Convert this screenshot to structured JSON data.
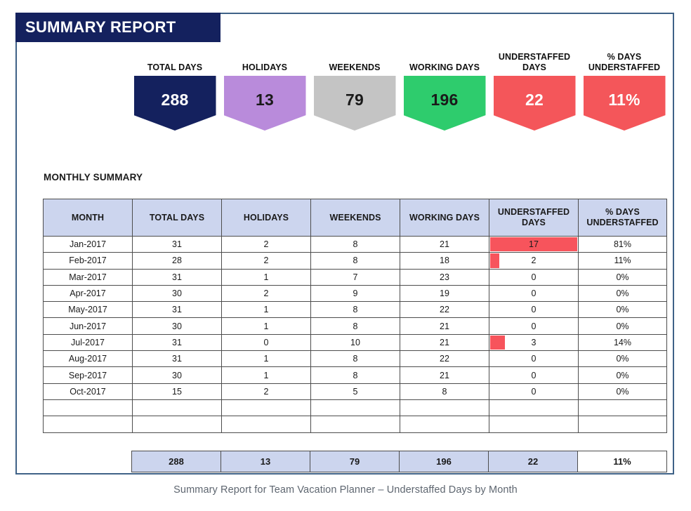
{
  "report": {
    "title": "SUMMARY REPORT",
    "section_heading": "MONTHLY SUMMARY",
    "caption": "Summary Report for Team Vacation Planner – Understaffed Days by Month"
  },
  "colors": {
    "title_bar": "#14215e",
    "frame_border": "#3f6287",
    "header_fill": "#ccd5ee",
    "databar": "#f7545c",
    "kpi_total_days": "#14215e",
    "kpi_holidays": "#b98bdb",
    "kpi_weekends": "#c4c4c4",
    "kpi_working_days": "#2ecc6d",
    "kpi_understaffed_days": "#f4565a",
    "kpi_pct_understaffed": "#f4565a"
  },
  "kpis": [
    {
      "label_line1": "TOTAL DAYS",
      "label_line2": "",
      "value": "288",
      "fill": "#14215e",
      "text_color": "#ffffff"
    },
    {
      "label_line1": "HOLIDAYS",
      "label_line2": "",
      "value": "13",
      "fill": "#b98bdb",
      "text_color": "#1a1a1a"
    },
    {
      "label_line1": "WEEKENDS",
      "label_line2": "",
      "value": "79",
      "fill": "#c4c4c4",
      "text_color": "#1a1a1a"
    },
    {
      "label_line1": "WORKING DAYS",
      "label_line2": "",
      "value": "196",
      "fill": "#2ecc6d",
      "text_color": "#1a1a1a"
    },
    {
      "label_line1": "UNDERSTAFFED",
      "label_line2": "DAYS",
      "value": "22",
      "fill": "#f4565a",
      "text_color": "#ffffff"
    },
    {
      "label_line1": "% DAYS",
      "label_line2": "UNDERSTAFFED",
      "value": "11%",
      "fill": "#f4565a",
      "text_color": "#ffffff"
    }
  ],
  "table": {
    "columns": [
      {
        "line1": "MONTH",
        "line2": ""
      },
      {
        "line1": "TOTAL DAYS",
        "line2": ""
      },
      {
        "line1": "HOLIDAYS",
        "line2": ""
      },
      {
        "line1": "WEEKENDS",
        "line2": ""
      },
      {
        "line1": "WORKING DAYS",
        "line2": ""
      },
      {
        "line1": "UNDERSTAFFED",
        "line2": "DAYS"
      },
      {
        "line1": "% DAYS",
        "line2": "UNDERSTAFFED"
      }
    ],
    "rows": [
      {
        "month": "Jan-2017",
        "total_days": "31",
        "holidays": "2",
        "weekends": "8",
        "working_days": "21",
        "understaffed_days": "17",
        "databar_pct": 100,
        "pct_understaffed": "81%"
      },
      {
        "month": "Feb-2017",
        "total_days": "28",
        "holidays": "2",
        "weekends": "8",
        "working_days": "18",
        "understaffed_days": "2",
        "databar_pct": 12,
        "pct_understaffed": "11%"
      },
      {
        "month": "Mar-2017",
        "total_days": "31",
        "holidays": "1",
        "weekends": "7",
        "working_days": "23",
        "understaffed_days": "0",
        "databar_pct": 0,
        "pct_understaffed": "0%"
      },
      {
        "month": "Apr-2017",
        "total_days": "30",
        "holidays": "2",
        "weekends": "9",
        "working_days": "19",
        "understaffed_days": "0",
        "databar_pct": 0,
        "pct_understaffed": "0%"
      },
      {
        "month": "May-2017",
        "total_days": "31",
        "holidays": "1",
        "weekends": "8",
        "working_days": "22",
        "understaffed_days": "0",
        "databar_pct": 0,
        "pct_understaffed": "0%"
      },
      {
        "month": "Jun-2017",
        "total_days": "30",
        "holidays": "1",
        "weekends": "8",
        "working_days": "21",
        "understaffed_days": "0",
        "databar_pct": 0,
        "pct_understaffed": "0%"
      },
      {
        "month": "Jul-2017",
        "total_days": "31",
        "holidays": "0",
        "weekends": "10",
        "working_days": "21",
        "understaffed_days": "3",
        "databar_pct": 18,
        "pct_understaffed": "14%"
      },
      {
        "month": "Aug-2017",
        "total_days": "31",
        "holidays": "1",
        "weekends": "8",
        "working_days": "22",
        "understaffed_days": "0",
        "databar_pct": 0,
        "pct_understaffed": "0%"
      },
      {
        "month": "Sep-2017",
        "total_days": "30",
        "holidays": "1",
        "weekends": "8",
        "working_days": "21",
        "understaffed_days": "0",
        "databar_pct": 0,
        "pct_understaffed": "0%"
      },
      {
        "month": "Oct-2017",
        "total_days": "15",
        "holidays": "2",
        "weekends": "5",
        "working_days": "8",
        "understaffed_days": "0",
        "databar_pct": 0,
        "pct_understaffed": "0%"
      }
    ],
    "blank_rows": 2,
    "totals": {
      "total_days": "288",
      "holidays": "13",
      "weekends": "79",
      "working_days": "196",
      "understaffed_days": "22",
      "pct_understaffed": "11%"
    }
  },
  "chart_data": {
    "type": "table",
    "title": "Monthly Summary – Understaffed Days by Month",
    "categories": [
      "Jan-2017",
      "Feb-2017",
      "Mar-2017",
      "Apr-2017",
      "May-2017",
      "Jun-2017",
      "Jul-2017",
      "Aug-2017",
      "Sep-2017",
      "Oct-2017"
    ],
    "series": [
      {
        "name": "Total Days",
        "values": [
          31,
          28,
          31,
          30,
          31,
          30,
          31,
          31,
          30,
          15
        ]
      },
      {
        "name": "Holidays",
        "values": [
          2,
          2,
          1,
          2,
          1,
          1,
          0,
          1,
          1,
          2
        ]
      },
      {
        "name": "Weekends",
        "values": [
          8,
          8,
          7,
          9,
          8,
          8,
          10,
          8,
          8,
          5
        ]
      },
      {
        "name": "Working Days",
        "values": [
          21,
          18,
          23,
          19,
          22,
          21,
          21,
          22,
          21,
          8
        ]
      },
      {
        "name": "Understaffed Days",
        "values": [
          17,
          2,
          0,
          0,
          0,
          0,
          3,
          0,
          0,
          0
        ]
      },
      {
        "name": "% Days Understaffed",
        "values": [
          81,
          11,
          0,
          0,
          0,
          0,
          14,
          0,
          0,
          0
        ]
      }
    ],
    "totals": {
      "Total Days": 288,
      "Holidays": 13,
      "Weekends": 79,
      "Working Days": 196,
      "Understaffed Days": 22,
      "% Days Understaffed": 11
    },
    "xlabel": "Month",
    "ylabel": "Days",
    "grid": true,
    "legend": "none"
  }
}
